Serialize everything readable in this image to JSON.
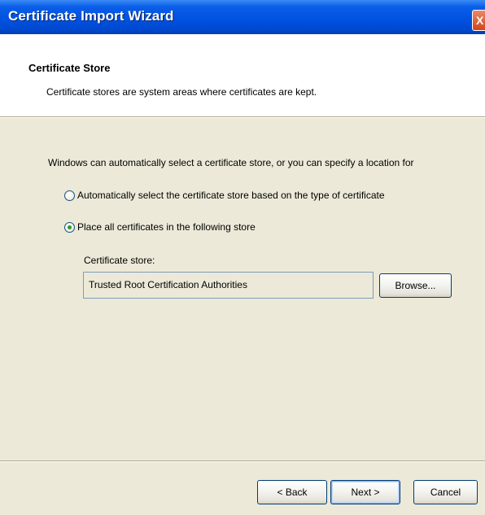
{
  "window": {
    "title": "Certificate Import Wizard",
    "close_glyph": "X"
  },
  "header": {
    "title": "Certificate Store",
    "description": "Certificate stores are system areas where certificates are kept."
  },
  "body": {
    "instruction": "Windows can automatically select a certificate store, or you can specify a location for",
    "options": [
      {
        "label": "Automatically select the certificate store based on the type of certificate",
        "selected": false
      },
      {
        "label": "Place all certificates in the following store",
        "selected": true
      }
    ],
    "store_label": "Certificate store:",
    "store_value": "Trusted Root Certification Authorities",
    "browse_label": "Browse..."
  },
  "footer": {
    "back_label": "< Back",
    "next_label": "Next >",
    "cancel_label": "Cancel"
  },
  "colors": {
    "titlebar": "#0052e0",
    "dialog_face": "#ece9d8",
    "header_bg": "#ffffff",
    "radio_dot": "#21a121",
    "close_button": "#d54518"
  },
  "icons": {
    "close": "close-icon",
    "radio": "radio-button-icon"
  }
}
